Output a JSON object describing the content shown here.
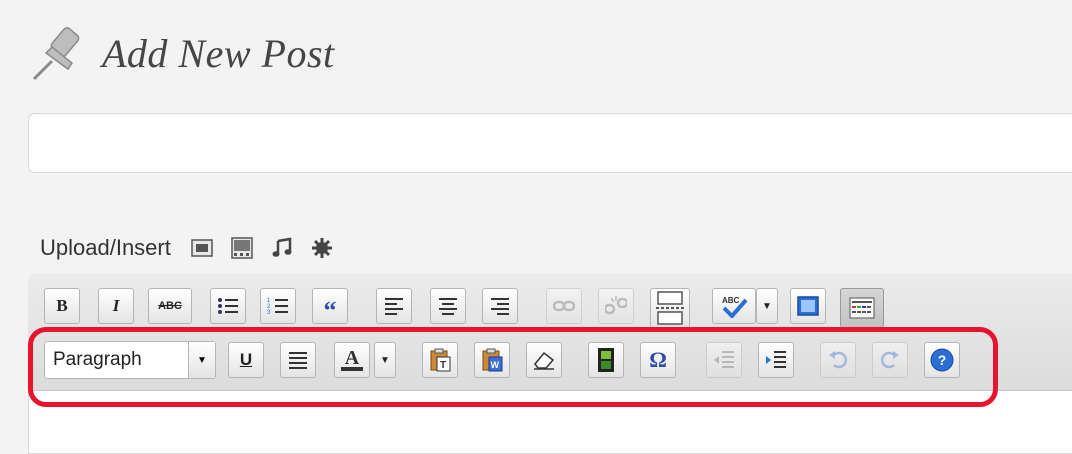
{
  "page": {
    "title": "Add New Post",
    "icon": "pushpin-icon"
  },
  "title_field": {
    "value": "",
    "placeholder": ""
  },
  "upload": {
    "label": "Upload/Insert",
    "icons": [
      "add-image-icon",
      "add-video-icon",
      "add-audio-icon",
      "add-media-icon"
    ]
  },
  "toolbar_row1": [
    {
      "name": "bold-button",
      "text": "B",
      "state": "normal"
    },
    {
      "name": "italic-button",
      "text": "I",
      "state": "normal"
    },
    {
      "name": "strikethrough-button",
      "text": "ABC",
      "state": "normal"
    },
    {
      "name": "unordered-list-button",
      "text": "",
      "state": "normal"
    },
    {
      "name": "ordered-list-button",
      "text": "",
      "state": "normal"
    },
    {
      "name": "blockquote-button",
      "text": "“",
      "state": "normal"
    },
    {
      "name": "align-left-button",
      "text": "",
      "state": "normal"
    },
    {
      "name": "align-center-button",
      "text": "",
      "state": "normal"
    },
    {
      "name": "align-right-button",
      "text": "",
      "state": "normal"
    },
    {
      "name": "insert-link-button",
      "text": "",
      "state": "disabled"
    },
    {
      "name": "unlink-button",
      "text": "",
      "state": "disabled"
    },
    {
      "name": "insert-more-button",
      "text": "",
      "state": "normal"
    },
    {
      "name": "spellcheck-button",
      "text": "",
      "state": "normal"
    },
    {
      "name": "fullscreen-button",
      "text": "",
      "state": "normal"
    },
    {
      "name": "kitchen-sink-button",
      "text": "",
      "state": "active"
    }
  ],
  "format_select": {
    "value": "Paragraph"
  },
  "toolbar_row2": [
    {
      "name": "underline-button",
      "text": "U",
      "state": "normal"
    },
    {
      "name": "justify-button",
      "text": "",
      "state": "normal"
    },
    {
      "name": "text-color-button",
      "text": "A",
      "state": "normal"
    },
    {
      "name": "paste-text-button",
      "text": "",
      "state": "normal"
    },
    {
      "name": "paste-word-button",
      "text": "",
      "state": "normal"
    },
    {
      "name": "remove-format-button",
      "text": "",
      "state": "normal"
    },
    {
      "name": "insert-media-button",
      "text": "",
      "state": "normal"
    },
    {
      "name": "special-character-button",
      "text": "Ω",
      "state": "normal"
    },
    {
      "name": "outdent-button",
      "text": "",
      "state": "disabled"
    },
    {
      "name": "indent-button",
      "text": "",
      "state": "normal"
    },
    {
      "name": "undo-button",
      "text": "",
      "state": "disabled"
    },
    {
      "name": "redo-button",
      "text": "",
      "state": "disabled"
    },
    {
      "name": "help-button",
      "text": "?",
      "state": "normal"
    }
  ],
  "colors": {
    "highlight": "#e8132c",
    "blue_icon": "#2b6fd6"
  }
}
